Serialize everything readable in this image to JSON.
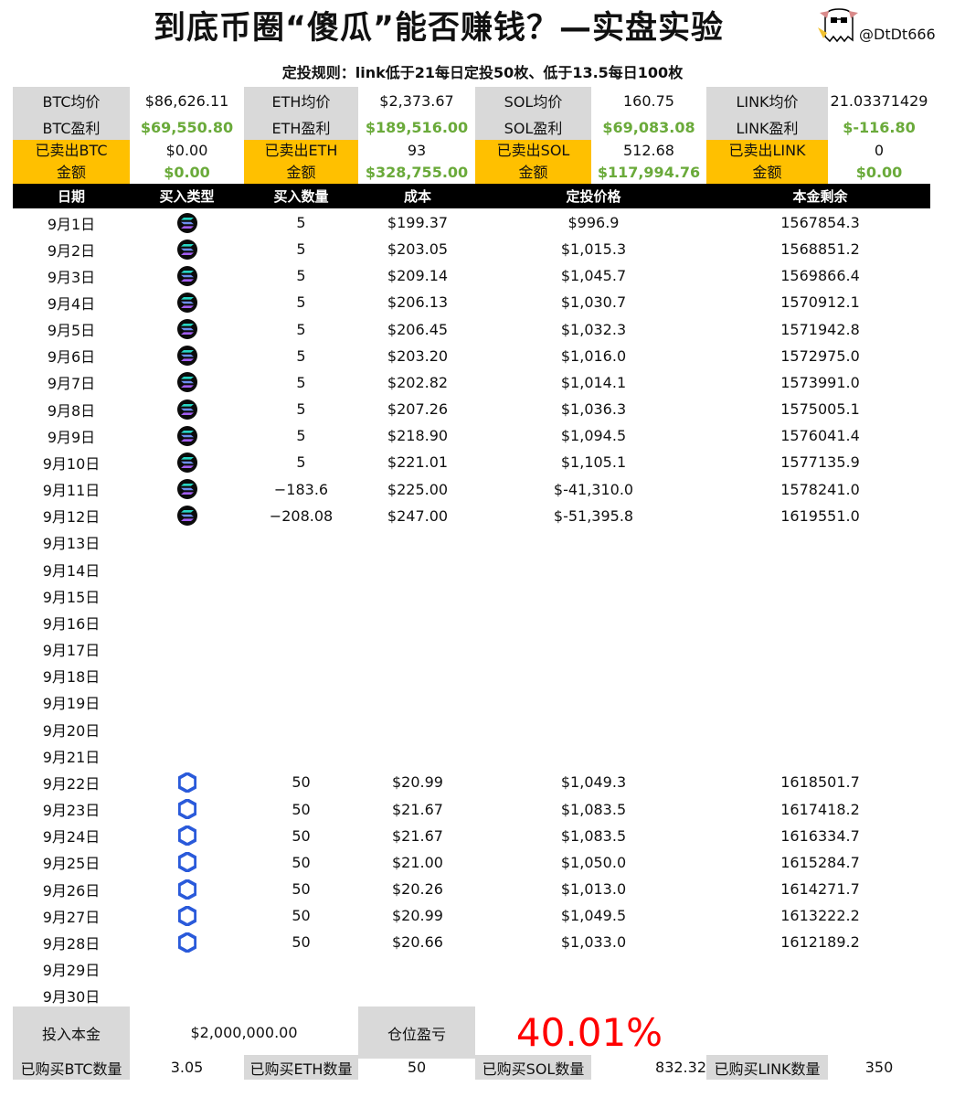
{
  "title": "到底币圈“傻瓜”能否赚钱？—实盘实验",
  "handle": "@DtDt666",
  "rule": "定投规则：link低于21每日定投50枚、低于13.5每日100枚",
  "summary": {
    "btc_avg_label": "BTC均价",
    "btc_avg": "$86,626.11",
    "eth_avg_label": "ETH均价",
    "eth_avg": "$2,373.67",
    "sol_avg_label": "SOL均价",
    "sol_avg": "160.75",
    "link_avg_label": "LINK均价",
    "link_avg": "21.03371429",
    "btc_profit_label": "BTC盈利",
    "btc_profit": "$69,550.80",
    "eth_profit_label": "ETH盈利",
    "eth_profit": "$189,516.00",
    "sol_profit_label": "SOL盈利",
    "sol_profit": "$69,083.08",
    "link_profit_label": "LINK盈利",
    "link_profit": "$-116.80",
    "btc_sold_label_1": "已卖出BTC",
    "btc_sold_label_2": "金额",
    "btc_sold_qty": "$0.00",
    "btc_sold_amt": "$0.00",
    "eth_sold_label_1": "已卖出ETH",
    "eth_sold_label_2": "金额",
    "eth_sold_qty": "93",
    "eth_sold_amt": "$328,755.00",
    "sol_sold_label_1": "已卖出SOL",
    "sol_sold_label_2": "金额",
    "sol_sold_qty": "512.68",
    "sol_sold_amt": "$117,994.76",
    "link_sold_label_1": "已卖出LINK",
    "link_sold_label_2": "金额",
    "link_sold_qty": "0",
    "link_sold_amt": "$0.00"
  },
  "table": {
    "headers": [
      "日期",
      "买入类型",
      "买入数量",
      "成本",
      "定投价格",
      "本金剩余"
    ],
    "rows": [
      {
        "date": "9月1日",
        "type": "sol-icon",
        "qty": "5",
        "cost": "$199.37",
        "price": "$996.9",
        "remain": "1567854.3"
      },
      {
        "date": "9月2日",
        "type": "sol-icon",
        "qty": "5",
        "cost": "$203.05",
        "price": "$1,015.3",
        "remain": "1568851.2"
      },
      {
        "date": "9月3日",
        "type": "sol-icon",
        "qty": "5",
        "cost": "$209.14",
        "price": "$1,045.7",
        "remain": "1569866.4"
      },
      {
        "date": "9月4日",
        "type": "sol-icon",
        "qty": "5",
        "cost": "$206.13",
        "price": "$1,030.7",
        "remain": "1570912.1"
      },
      {
        "date": "9月5日",
        "type": "sol-icon",
        "qty": "5",
        "cost": "$206.45",
        "price": "$1,032.3",
        "remain": "1571942.8"
      },
      {
        "date": "9月6日",
        "type": "sol-icon",
        "qty": "5",
        "cost": "$203.20",
        "price": "$1,016.0",
        "remain": "1572975.0"
      },
      {
        "date": "9月7日",
        "type": "sol-icon",
        "qty": "5",
        "cost": "$202.82",
        "price": "$1,014.1",
        "remain": "1573991.0"
      },
      {
        "date": "9月8日",
        "type": "sol-icon",
        "qty": "5",
        "cost": "$207.26",
        "price": "$1,036.3",
        "remain": "1575005.1"
      },
      {
        "date": "9月9日",
        "type": "sol-icon",
        "qty": "5",
        "cost": "$218.90",
        "price": "$1,094.5",
        "remain": "1576041.4"
      },
      {
        "date": "9月10日",
        "type": "sol-icon",
        "qty": "5",
        "cost": "$221.01",
        "price": "$1,105.1",
        "remain": "1577135.9"
      },
      {
        "date": "9月11日",
        "type": "sol-icon",
        "qty": "−183.6",
        "cost": "$225.00",
        "price": "$-41,310.0",
        "remain": "1578241.0"
      },
      {
        "date": "9月12日",
        "type": "sol-icon",
        "qty": "−208.08",
        "cost": "$247.00",
        "price": "$-51,395.8",
        "remain": "1619551.0"
      },
      {
        "date": "9月13日",
        "type": "",
        "qty": "",
        "cost": "",
        "price": "",
        "remain": ""
      },
      {
        "date": "9月14日",
        "type": "",
        "qty": "",
        "cost": "",
        "price": "",
        "remain": ""
      },
      {
        "date": "9月15日",
        "type": "",
        "qty": "",
        "cost": "",
        "price": "",
        "remain": ""
      },
      {
        "date": "9月16日",
        "type": "",
        "qty": "",
        "cost": "",
        "price": "",
        "remain": ""
      },
      {
        "date": "9月17日",
        "type": "",
        "qty": "",
        "cost": "",
        "price": "",
        "remain": ""
      },
      {
        "date": "9月18日",
        "type": "",
        "qty": "",
        "cost": "",
        "price": "",
        "remain": ""
      },
      {
        "date": "9月19日",
        "type": "",
        "qty": "",
        "cost": "",
        "price": "",
        "remain": ""
      },
      {
        "date": "9月20日",
        "type": "",
        "qty": "",
        "cost": "",
        "price": "",
        "remain": ""
      },
      {
        "date": "9月21日",
        "type": "",
        "qty": "",
        "cost": "",
        "price": "",
        "remain": ""
      },
      {
        "date": "9月22日",
        "type": "link-icon",
        "qty": "50",
        "cost": "$20.99",
        "price": "$1,049.3",
        "remain": "1618501.7"
      },
      {
        "date": "9月23日",
        "type": "link-icon",
        "qty": "50",
        "cost": "$21.67",
        "price": "$1,083.5",
        "remain": "1617418.2"
      },
      {
        "date": "9月24日",
        "type": "link-icon",
        "qty": "50",
        "cost": "$21.67",
        "price": "$1,083.5",
        "remain": "1616334.7"
      },
      {
        "date": "9月25日",
        "type": "link-icon",
        "qty": "50",
        "cost": "$21.00",
        "price": "$1,050.0",
        "remain": "1615284.7"
      },
      {
        "date": "9月26日",
        "type": "link-icon",
        "qty": "50",
        "cost": "$20.26",
        "price": "$1,013.0",
        "remain": "1614271.7"
      },
      {
        "date": "9月27日",
        "type": "link-icon",
        "qty": "50",
        "cost": "$20.99",
        "price": "$1,049.5",
        "remain": "1613222.2"
      },
      {
        "date": "9月28日",
        "type": "link-icon",
        "qty": "50",
        "cost": "$20.66",
        "price": "$1,033.0",
        "remain": "1612189.2"
      },
      {
        "date": "9月29日",
        "type": "",
        "qty": "",
        "cost": "",
        "price": "",
        "remain": ""
      },
      {
        "date": "9月30日",
        "type": "",
        "qty": "",
        "cost": "",
        "price": "",
        "remain": ""
      }
    ]
  },
  "footer": {
    "principal_label": "投入本金",
    "principal": "$2,000,000.00",
    "pnl_label": "仓位盈亏",
    "pnl": "40.01%",
    "btc_qty_label": "已购买BTC数量",
    "btc_qty": "3.05",
    "eth_qty_label": "已购买ETH数量",
    "eth_qty": "50",
    "sol_qty_label": "已购买SOL数量",
    "sol_qty": "832.32",
    "link_qty_label": "已购买LINK数量",
    "link_qty": "350"
  },
  "colors": {
    "accent_gold": "#ffc000",
    "label_grey": "#d9d9d9",
    "profit_green": "#6aaa3a",
    "pnl_red": "#ff0000",
    "sol_icon_bg": "#0b0b0b",
    "link_blue": "#2a5ada"
  }
}
